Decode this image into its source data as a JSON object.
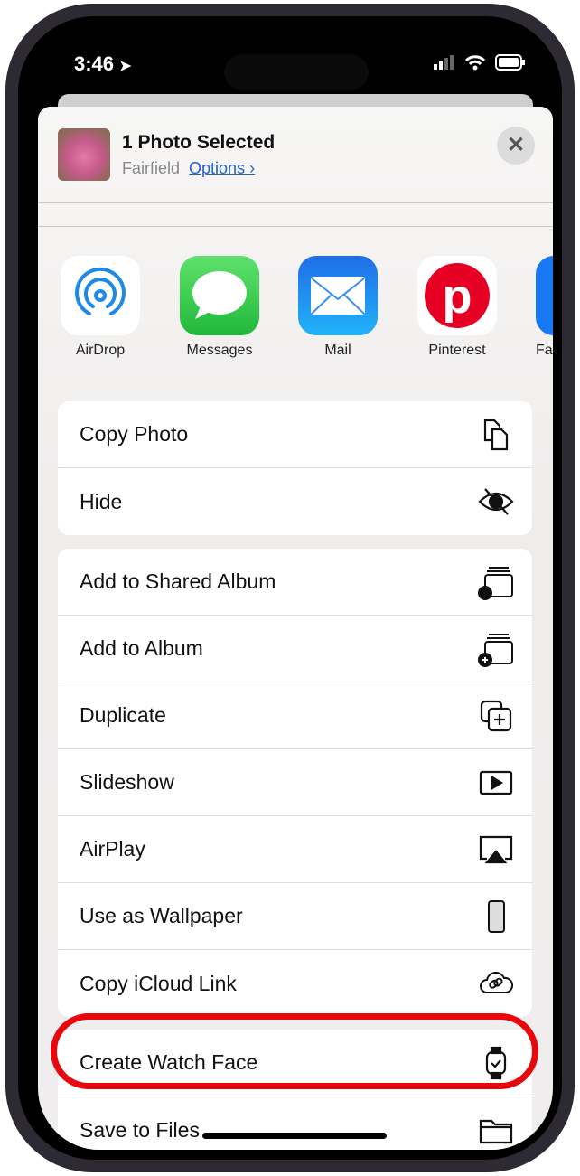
{
  "status": {
    "time": "3:46",
    "location_icon": "location-arrow-icon",
    "signal_icon": "signal-icon",
    "wifi_icon": "wifi-icon",
    "battery_icon": "battery-icon"
  },
  "header": {
    "title": "1 Photo Selected",
    "location": "Fairfield",
    "options_label": "Options ›",
    "close_icon": "close-icon"
  },
  "apps": [
    {
      "label": "AirDrop",
      "color": "#ffffff"
    },
    {
      "label": "Messages",
      "color": "#34c759"
    },
    {
      "label": "Mail",
      "color": "#1e8ef5"
    },
    {
      "label": "Pinterest",
      "color": "#e60023"
    },
    {
      "label": "Fa",
      "color": "#1877f2"
    }
  ],
  "groups": [
    [
      {
        "label": "Copy Photo",
        "icon": "copy-icon"
      },
      {
        "label": "Hide",
        "icon": "eye-slash-icon"
      }
    ],
    [
      {
        "label": "Add to Shared Album",
        "icon": "shared-album-icon"
      },
      {
        "label": "Add to Album",
        "icon": "add-album-icon"
      },
      {
        "label": "Duplicate",
        "icon": "duplicate-icon"
      },
      {
        "label": "Slideshow",
        "icon": "play-rectangle-icon"
      },
      {
        "label": "AirPlay",
        "icon": "airplay-icon"
      },
      {
        "label": "Use as Wallpaper",
        "icon": "iphone-icon"
      },
      {
        "label": "Copy iCloud Link",
        "icon": "cloud-link-icon"
      }
    ],
    [
      {
        "label": "Create Watch Face",
        "icon": "watch-icon"
      },
      {
        "label": "Save to Files",
        "icon": "folder-icon"
      }
    ]
  ],
  "highlight_color": "#e8070b"
}
